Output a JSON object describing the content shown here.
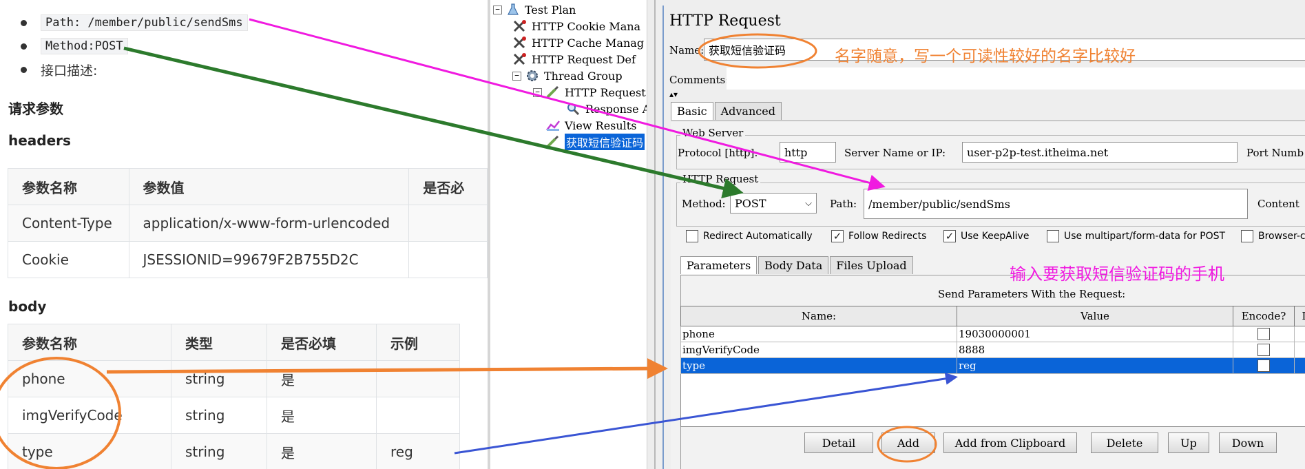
{
  "doc": {
    "bullets": [
      {
        "code": "Path: /member/public/sendSms"
      },
      {
        "code": "Method:POST"
      },
      {
        "text": "接口描述:"
      }
    ],
    "req_params_heading": "请求参数",
    "headers_heading": "headers",
    "headers_table": {
      "columns": [
        "参数名称",
        "参数值",
        "是否必"
      ],
      "rows": [
        [
          "Content-Type",
          "application/x-www-form-urlencoded",
          ""
        ],
        [
          "Cookie",
          "JSESSIONID=99679F2B755D2C",
          ""
        ]
      ]
    },
    "body_heading": "body",
    "body_table": {
      "columns": [
        "参数名称",
        "类型",
        "是否必填",
        "示例"
      ],
      "rows": [
        [
          "phone",
          "string",
          "是",
          ""
        ],
        [
          "imgVerifyCode",
          "string",
          "是",
          ""
        ],
        [
          "type",
          "string",
          "是",
          "reg"
        ]
      ]
    }
  },
  "tree": {
    "nodes": [
      {
        "label": "Test Plan",
        "icon": "test-plan-icon"
      },
      {
        "label": "HTTP Cookie Mana",
        "icon": "wrench-icon"
      },
      {
        "label": "HTTP Cache Manag",
        "icon": "wrench-icon"
      },
      {
        "label": "HTTP Request Def",
        "icon": "wrench-icon"
      },
      {
        "label": "Thread Group",
        "icon": "gear-icon"
      },
      {
        "label": "HTTP Request",
        "icon": "pipette-icon"
      },
      {
        "label": "Response A",
        "icon": "magnifier-icon"
      },
      {
        "label": "View Results",
        "icon": "chart-icon"
      },
      {
        "label": "获取短信验证码",
        "icon": "pipette-icon"
      }
    ]
  },
  "jmeter": {
    "title": "HTTP Request",
    "name_label": "Name:",
    "name_value": "获取短信验证码",
    "comments_label": "Comments:",
    "tabs": [
      "Basic",
      "Advanced"
    ],
    "web_server_title": "Web Server",
    "protocol_label": "Protocol [http]:",
    "protocol_value": "http",
    "server_label": "Server Name or IP:",
    "server_value": "user-p2p-test.itheima.net",
    "port_label": "Port Numb",
    "http_request_title": "HTTP Request",
    "method_label": "Method:",
    "method_value": "POST",
    "path_label": "Path:",
    "path_value": "/member/public/sendSms",
    "content_label": "Content",
    "checkboxes": [
      {
        "label": "Redirect Automatically",
        "checked": false
      },
      {
        "label": "Follow Redirects",
        "checked": true
      },
      {
        "label": "Use KeepAlive",
        "checked": true
      },
      {
        "label": "Use multipart/form-data for POST",
        "checked": false
      },
      {
        "label": "Browser-c",
        "checked": false
      }
    ],
    "param_tabs": [
      "Parameters",
      "Body Data",
      "Files Upload"
    ],
    "send_params_title": "Send Parameters With the Request:",
    "param_columns": [
      "Name:",
      "Value",
      "Encode?",
      "I"
    ],
    "params": [
      {
        "name": "phone",
        "value": "19030000001"
      },
      {
        "name": "imgVerifyCode",
        "value": "8888"
      },
      {
        "name": "type",
        "value": "reg"
      }
    ],
    "buttons": [
      "Detail",
      "Add",
      "Add from Clipboard",
      "Delete",
      "Up",
      "Down"
    ]
  },
  "annotations": {
    "name_note": "名字随意，写一个可读性较好的名字比较好",
    "phone_note": "输入要获取短信验证码的手机",
    "colors": {
      "orange": "#f08232",
      "magenta": "#f01ae0",
      "green": "#2c7a2c",
      "blue": "#3a55d4"
    }
  }
}
